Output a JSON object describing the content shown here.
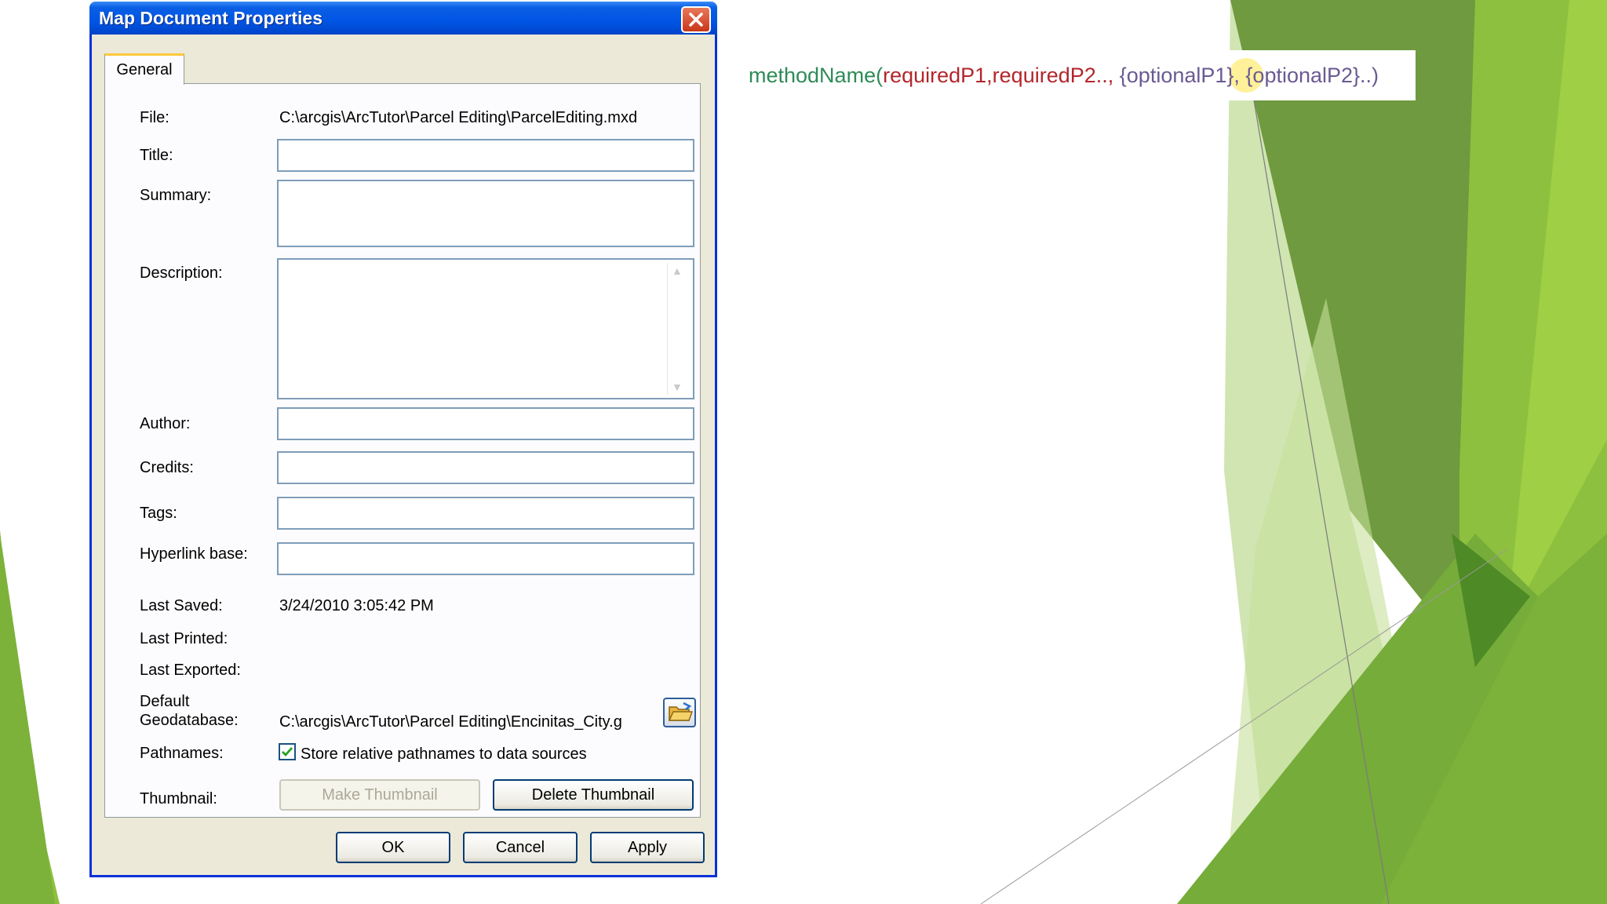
{
  "snippet": {
    "method": "methodName(",
    "required": "requiredP1,requiredP2..,",
    "optional": " {optionalP1}, {optionalP2}..)"
  },
  "dialog": {
    "title": "Map Document Properties",
    "tab_general": "General",
    "labels": {
      "file": "File:",
      "title": "Title:",
      "summary": "Summary:",
      "description": "Description:",
      "author": "Author:",
      "credits": "Credits:",
      "tags": "Tags:",
      "hyperlink_base": "Hyperlink base:",
      "last_saved": "Last Saved:",
      "last_printed": "Last Printed:",
      "last_exported": "Last Exported:",
      "default_geodatabase_1": "Default",
      "default_geodatabase_2": "Geodatabase:",
      "pathnames": "Pathnames:",
      "thumbnail": "Thumbnail:"
    },
    "values": {
      "file": "C:\\arcgis\\ArcTutor\\Parcel Editing\\ParcelEditing.mxd",
      "title": "",
      "summary": "",
      "description": "",
      "author": "",
      "credits": "",
      "tags": "",
      "hyperlink_base": "",
      "last_saved": "3/24/2010 3:05:42 PM",
      "last_printed": "",
      "last_exported": "",
      "default_geodatabase": "C:\\arcgis\\ArcTutor\\Parcel Editing\\Encinitas_City.g"
    },
    "pathnames_checkbox": {
      "label": "Store relative pathnames to data sources",
      "checked": true
    },
    "buttons": {
      "make_thumbnail": "Make Thumbnail",
      "delete_thumbnail": "Delete Thumbnail",
      "ok": "OK",
      "cancel": "Cancel",
      "apply": "Apply"
    }
  },
  "colors": {
    "titlebar": "#0055e5",
    "dialog_bg": "#ece9d8",
    "method_text": "#2e8b57",
    "required_text": "#b3262d",
    "optional_text": "#6a5a93",
    "green_accent": "#8cc63f"
  }
}
